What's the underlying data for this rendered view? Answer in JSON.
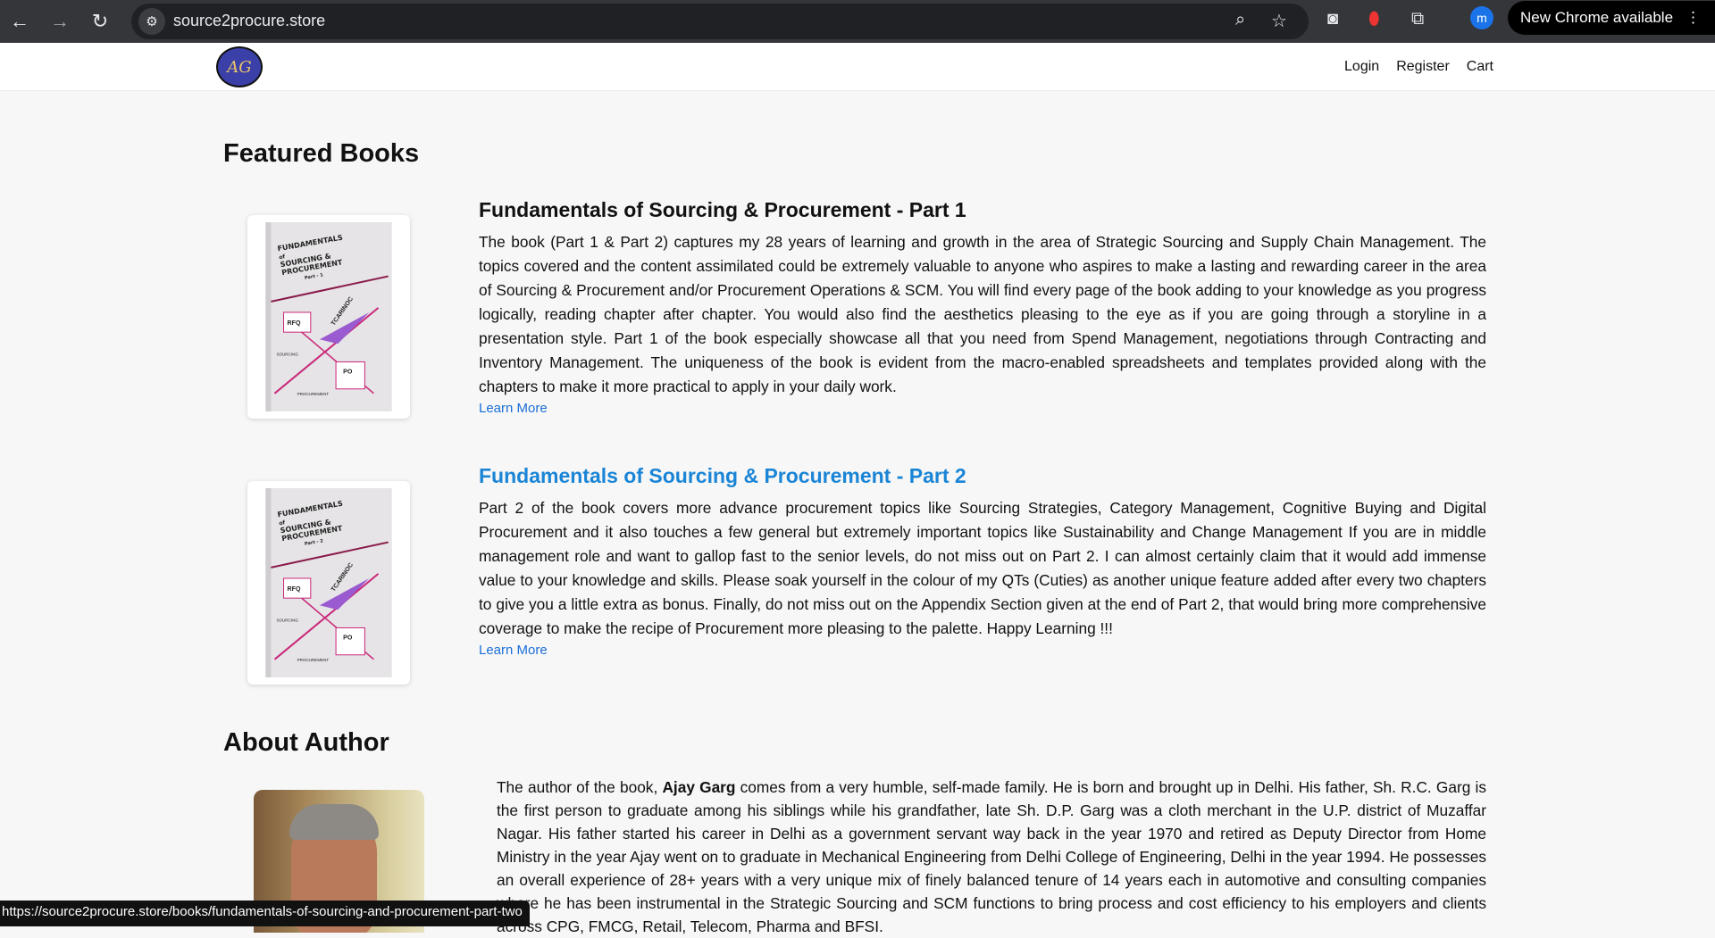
{
  "browser": {
    "url": "source2procure.store",
    "new_chrome": "New Chrome available",
    "profile_initial": "m",
    "status_url": "https://source2procure.store/books/fundamentals-of-sourcing-and-procurement-part-two"
  },
  "nav": {
    "logo_text": "AG",
    "links": [
      "Login",
      "Register",
      "Cart"
    ]
  },
  "featured": {
    "heading": "Featured Books",
    "books": [
      {
        "title": "Fundamentals of Sourcing & Procurement - Part 1",
        "cover_part": "Part - 1",
        "description": "The book (Part 1 & Part 2) captures my 28 years of learning and growth in the area of Strategic Sourcing and Supply Chain Management. The topics covered and the content assimilated could be extremely valuable to anyone who aspires to make a lasting and rewarding career in the area of Sourcing & Procurement and/or Procurement Operations & SCM. You will find every page of the book adding to your knowledge as you progress logically, reading chapter after chapter. You would also find the aesthetics pleasing to the eye as if you are going through a storyline in a presentation style. Part 1 of the book especially showcase all that you need from Spend Management, negotiations through Contracting and Inventory Management. The uniqueness of the book is evident from the macro-enabled spreadsheets and templates provided along with the chapters to make it more practical to apply in your daily work.",
        "learn_more": "Learn More"
      },
      {
        "title": "Fundamentals of Sourcing & Procurement - Part 2",
        "cover_part": "Part - 2",
        "description": "Part 2 of the book covers more advance procurement topics like Sourcing Strategies, Category Management, Cognitive Buying and Digital Procurement and it also touches a few general but extremely important topics like Sustainability and Change Management If you are in middle management role and want to gallop fast to the senior levels, do not miss out on Part 2. I can almost certainly claim that it would add immense value to your knowledge and skills. Please soak yourself in the colour of my QTs (Cuties) as another unique feature added after every two chapters to give you a little extra as bonus. Finally, do not miss out on the Appendix Section given at the end of Part 2, that would bring more comprehensive coverage to make the recipe of Procurement more pleasing to the palette. Happy Learning !!!",
        "learn_more": "Learn More"
      }
    ]
  },
  "cover": {
    "l1": "FUNDAMENTALS",
    "l2": "of",
    "l3": "SOURCING &",
    "l4": "PROCUREMENT",
    "rfq": "RFQ",
    "po": "PO",
    "sourcing": "SOURCING",
    "procurement": "PROCUREMENT",
    "brand": "TCARINOC"
  },
  "about": {
    "heading": "About Author",
    "intro": "The author of the book, ",
    "name": "Ajay Garg",
    "bio": " comes from a very humble, self-made family. He is born and brought up in Delhi. His father, Sh. R.C. Garg is the first person to graduate among his siblings while his grandfather, late Sh. D.P. Garg was a cloth merchant in the U.P. district of Muzaffar Nagar. His father started his career in Delhi as a government servant way back in the year 1970 and retired as Deputy Director from Home Ministry in the year Ajay went on to graduate in Mechanical Engineering from Delhi College of Engineering, Delhi in the year 1994. He possesses an overall experience of 28+ years with a very unique mix of finely balanced tenure of 14 years each in automotive and consulting companies where he has been instrumental in the Strategic Sourcing and SCM functions to bring process and cost efficiency to his employers and clients across CPG, FMCG, Retail, Telecom, Pharma and BFSI."
  }
}
